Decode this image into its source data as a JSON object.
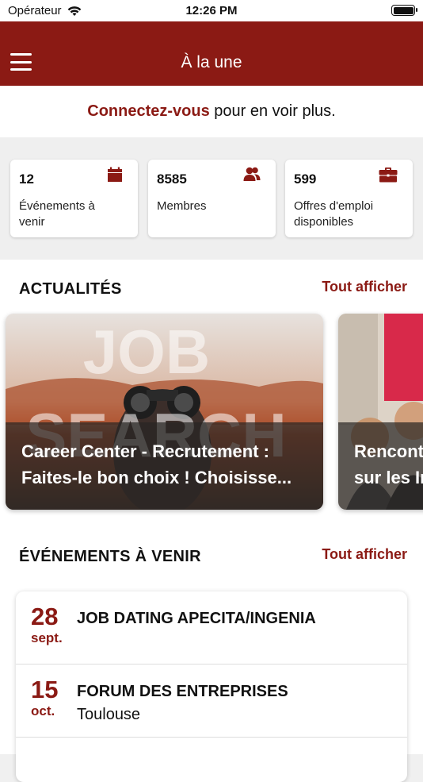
{
  "status_bar": {
    "carrier": "Opérateur",
    "time": "12:26 PM"
  },
  "nav": {
    "title": "À la une"
  },
  "login_prompt": {
    "link": "Connectez-vous",
    "rest": " pour en voir plus."
  },
  "stats": [
    {
      "value": "12",
      "label": "Événements à venir",
      "icon": "calendar-icon"
    },
    {
      "value": "8585",
      "label": "Membres",
      "icon": "members-icon"
    },
    {
      "value": "599",
      "label": "Offres d'emploi disponibles",
      "icon": "briefcase-icon"
    }
  ],
  "news": {
    "title": "ACTUALITÉS",
    "see_all": "Tout afficher",
    "items": [
      {
        "caption_line1": "Career Center - Recrutement :",
        "caption_line2": "Faites-le bon choix ! Choisisse...",
        "image_text_1": "JOB",
        "image_text_2": "SEARCH"
      },
      {
        "caption_line1": "Rencont",
        "caption_line2": "sur les In"
      }
    ]
  },
  "events": {
    "title": "ÉVÉNEMENTS À VENIR",
    "see_all": "Tout afficher",
    "items": [
      {
        "day": "28",
        "month": "sept.",
        "name": "JOB DATING APECITA/INGENIA",
        "location": ""
      },
      {
        "day": "15",
        "month": "oct.",
        "name": "FORUM DES ENTREPRISES",
        "location": "Toulouse"
      },
      {
        "day": "",
        "month": "",
        "name": "",
        "location": ""
      }
    ]
  },
  "colors": {
    "brand": "#8b1a14",
    "background": "#efefef"
  }
}
